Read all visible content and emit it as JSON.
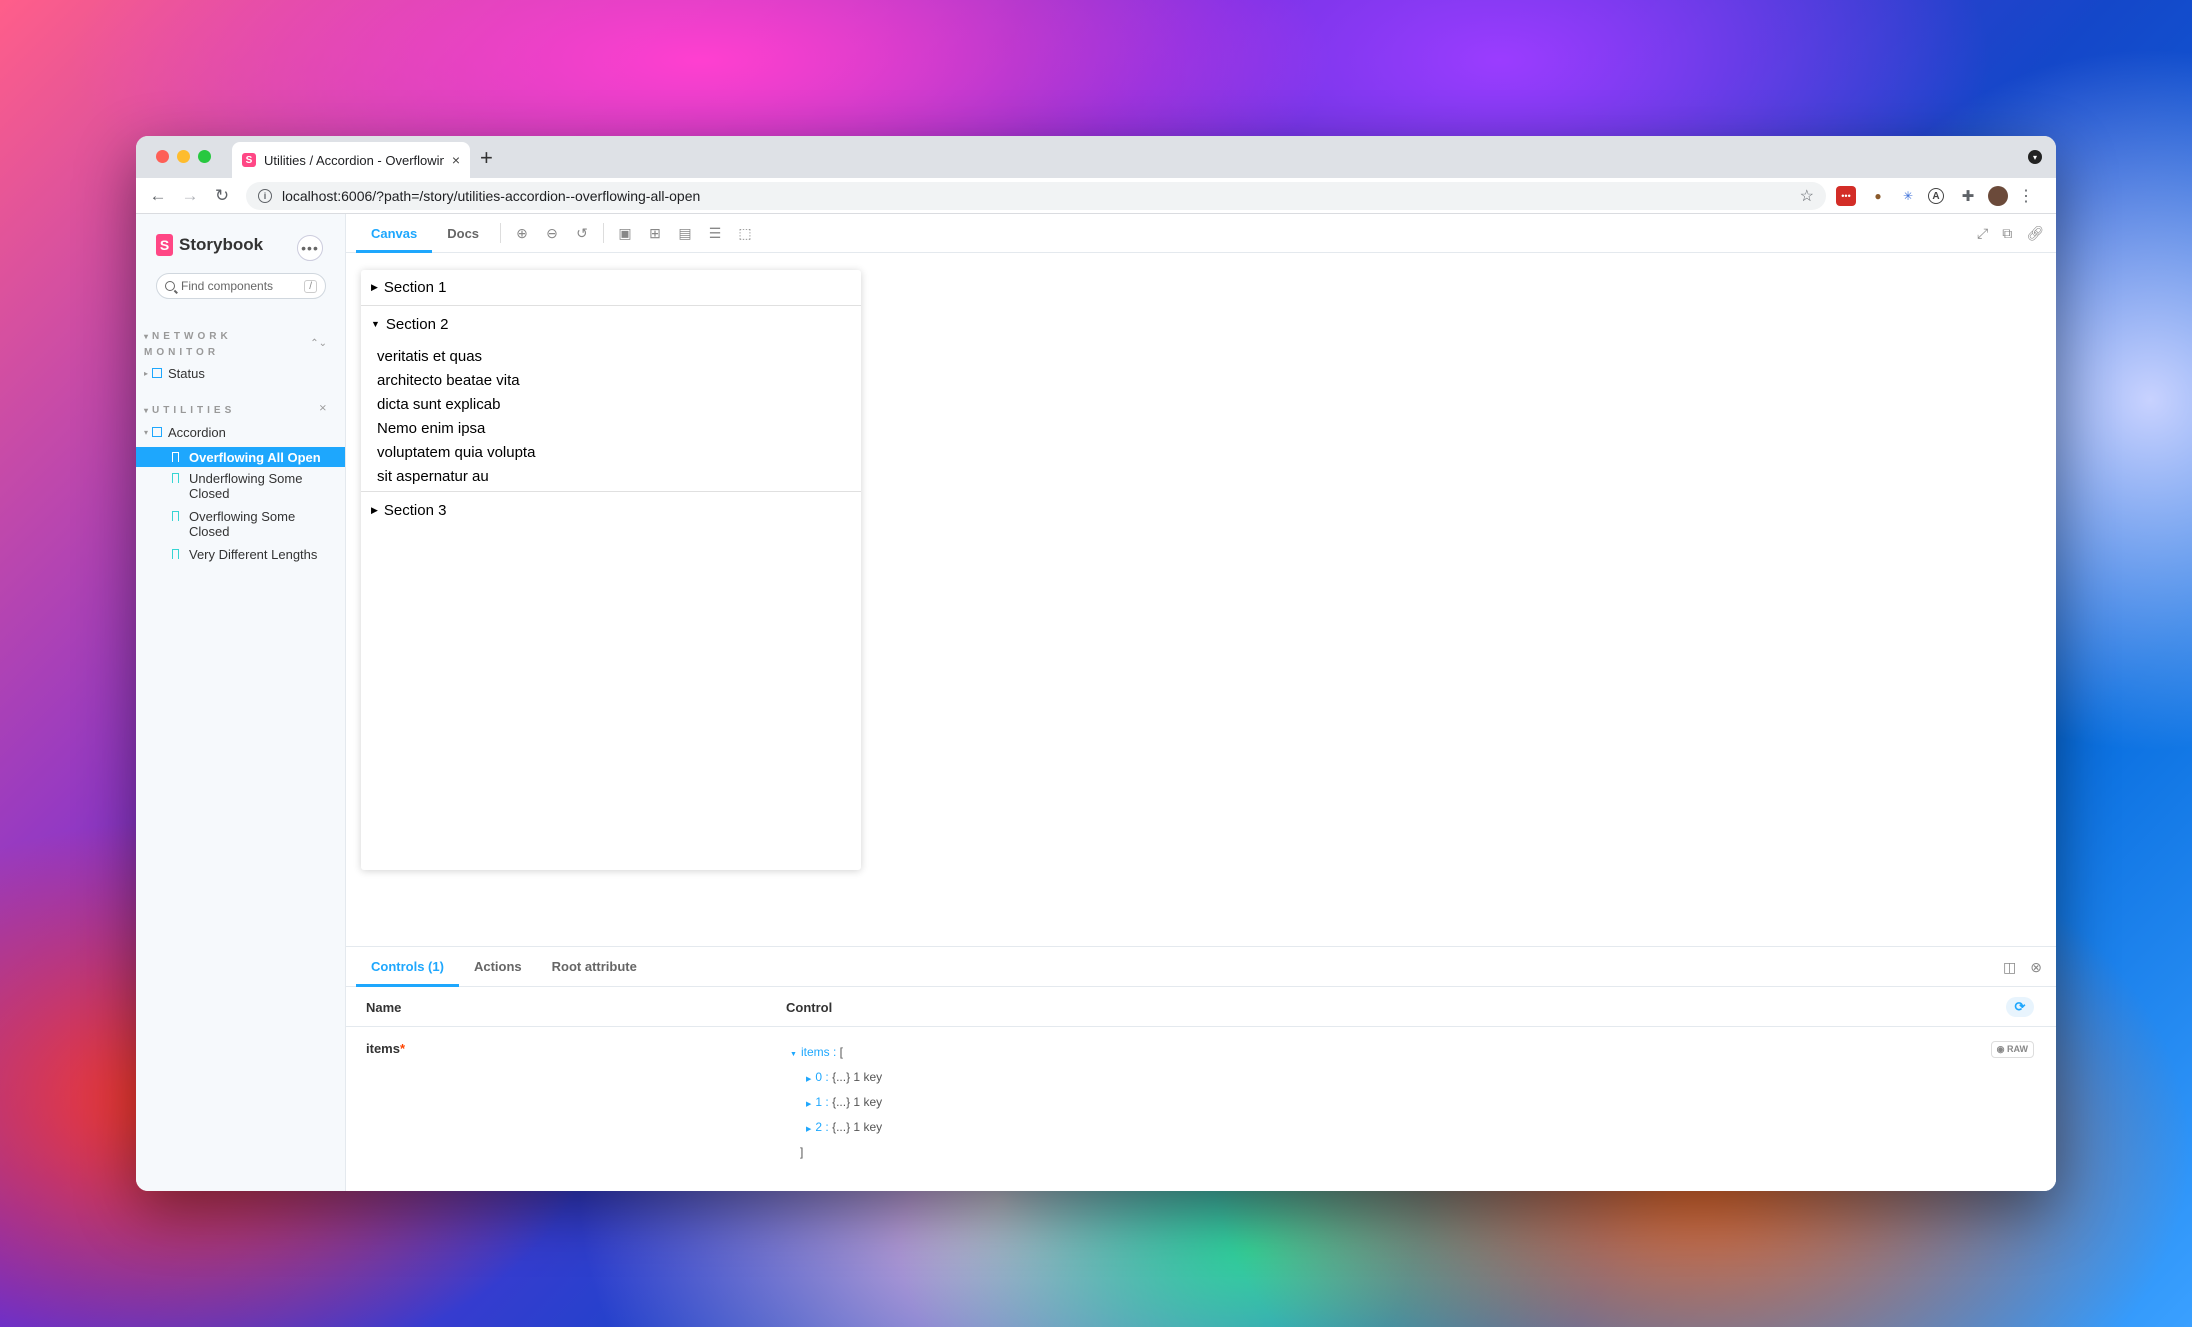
{
  "browser": {
    "tab_title": "Utilities / Accordion - Overflowing All Open",
    "tab_favicon": "S",
    "url": "localhost:6006/?path=/story/utilities-accordion--overflowing-all-open",
    "new_tab_symbol": "+",
    "close_symbol": "×"
  },
  "sidebar": {
    "brand": "Storybook",
    "brand_logo": "S",
    "menu_symbol": "•••",
    "search_placeholder": "Find components",
    "search_shortcut": "/",
    "groups": [
      {
        "label": "NETWORK MONITOR",
        "items": [
          {
            "label": "Status"
          }
        ]
      },
      {
        "label": "UTILITIES",
        "component": "Accordion",
        "stories": [
          {
            "label": "Overflowing All Open",
            "active": true
          },
          {
            "label": "Underflowing Some Closed"
          },
          {
            "label": "Overflowing Some Closed"
          },
          {
            "label": "Very Different Lengths"
          }
        ]
      }
    ]
  },
  "toolbar": {
    "tabs": [
      {
        "label": "Canvas",
        "active": true
      },
      {
        "label": "Docs"
      }
    ]
  },
  "accordion": {
    "sections": [
      {
        "title": "Section 1",
        "open": false
      },
      {
        "title": "Section 2",
        "open": true,
        "lines": [
          "veritatis et quas",
          "architecto beatae vita",
          "dicta sunt explicab",
          "Nemo enim ipsa",
          "voluptatem quia volupta",
          "sit aspernatur au"
        ]
      },
      {
        "title": "Section 3",
        "open": false
      }
    ]
  },
  "addons": {
    "tabs": [
      {
        "label": "Controls (1)",
        "active": true
      },
      {
        "label": "Actions"
      },
      {
        "label": "Root attribute"
      }
    ],
    "columns": {
      "name": "Name",
      "control": "Control"
    },
    "row": {
      "name": "items",
      "required": "*",
      "raw_label": "RAW",
      "json": {
        "key": "items :",
        "open": "[",
        "entries": [
          {
            "index": "0 :",
            "summary": "{...} 1 key"
          },
          {
            "index": "1 :",
            "summary": "{...} 1 key"
          },
          {
            "index": "2 :",
            "summary": "{...} 1 key"
          }
        ],
        "close": "]"
      }
    }
  },
  "colors": {
    "accent": "#1ea7fd",
    "brand": "#ff4785"
  }
}
